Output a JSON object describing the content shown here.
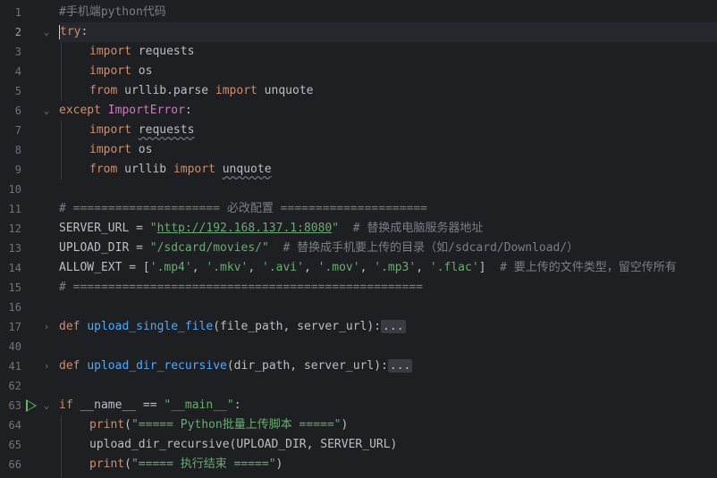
{
  "editor": {
    "language": "python",
    "current_line": "2",
    "lines": [
      {
        "n": "1",
        "fold": ""
      },
      {
        "n": "2",
        "fold": "⌄"
      },
      {
        "n": "3",
        "fold": ""
      },
      {
        "n": "4",
        "fold": ""
      },
      {
        "n": "5",
        "fold": ""
      },
      {
        "n": "6",
        "fold": "⌄"
      },
      {
        "n": "7",
        "fold": ""
      },
      {
        "n": "8",
        "fold": ""
      },
      {
        "n": "9",
        "fold": ""
      },
      {
        "n": "10",
        "fold": ""
      },
      {
        "n": "11",
        "fold": ""
      },
      {
        "n": "12",
        "fold": ""
      },
      {
        "n": "13",
        "fold": ""
      },
      {
        "n": "14",
        "fold": ""
      },
      {
        "n": "15",
        "fold": ""
      },
      {
        "n": "16",
        "fold": ""
      },
      {
        "n": "17",
        "fold": "›"
      },
      {
        "n": "40",
        "fold": ""
      },
      {
        "n": "41",
        "fold": "›"
      },
      {
        "n": "62",
        "fold": ""
      },
      {
        "n": "63",
        "fold": "⌄"
      },
      {
        "n": "64",
        "fold": ""
      },
      {
        "n": "65",
        "fold": ""
      },
      {
        "n": "66",
        "fold": ""
      }
    ],
    "tokens": {
      "l1": "#手机端python代码",
      "l2_kw": "try",
      "l2_p": ":",
      "l3_kw": "import",
      "l3_mod": " requests",
      "l4_kw": "import",
      "l4_mod": " os",
      "l5_kw": "from",
      "l5_mod": " urllib.parse ",
      "l5_kw2": "import",
      "l5_name": " unquote",
      "l6_kw": "except",
      "l6_sp": " ",
      "l6_cls": "ImportError",
      "l6_p": ":",
      "l7_kw": "import",
      "l7_sp": " ",
      "l7_mod": "requests",
      "l8_kw": "import",
      "l8_mod": " os",
      "l9_kw": "from",
      "l9_mod": " urllib ",
      "l9_kw2": "import",
      "l9_sp": " ",
      "l9_name": "unquote",
      "l11": "# ===================== 必改配置 =====================",
      "l12_a": "SERVER_URL = ",
      "l12_q1": "\"",
      "l12_url": "http://192.168.137.1:8080",
      "l12_q2": "\"",
      "l12_c": "  # 替换成电脑服务器地址",
      "l13_a": "UPLOAD_DIR = ",
      "l13_s": "\"/sdcard/movies/\"",
      "l13_c": "  # 替换成手机要上传的目录（如/sdcard/Download/）",
      "l14_a": "ALLOW_EXT = [",
      "l14_s1": "'.mp4'",
      "l14_s2": "'.mkv'",
      "l14_s3": "'.avi'",
      "l14_s4": "'.mov'",
      "l14_s5": "'.mp3'",
      "l14_s6": "'.flac'",
      "l14_sep": ", ",
      "l14_end": "]",
      "l14_c": "  # 要上传的文件类型，留空传所有",
      "l15": "# ==================================================",
      "l17_kw": "def",
      "l17_fn": "upload_single_file",
      "l17_args": "(file_path, server_url):",
      "l17_fold": "...",
      "l41_kw": "def",
      "l41_fn": "upload_dir_recursive",
      "l41_args": "(dir_path, server_url):",
      "l41_fold": "...",
      "l63_kw": "if",
      "l63_a": " __name__ == ",
      "l63_s": "\"__main__\"",
      "l63_p": ":",
      "l64_fn": "print",
      "l64_p1": "(",
      "l64_s": "\"===== Python批量上传脚本 =====\"",
      "l64_p2": ")",
      "l65": "upload_dir_recursive(UPLOAD_DIR, SERVER_URL)",
      "l66_fn": "print",
      "l66_p1": "(",
      "l66_s": "\"===== 执行结束 =====\"",
      "l66_p2": ")"
    }
  },
  "colors": {
    "background": "#1e1f22",
    "keyword": "#cf8e6d",
    "string": "#6aab73",
    "comment": "#7a7e85",
    "function": "#56a8f5",
    "class": "#c77dbb",
    "text": "#bcbec4",
    "run_icon": "#5fb865"
  },
  "icons": {
    "run_gutter": "run-triangle-icon",
    "fold_open": "chevron-down-icon",
    "fold_closed": "chevron-right-icon"
  }
}
